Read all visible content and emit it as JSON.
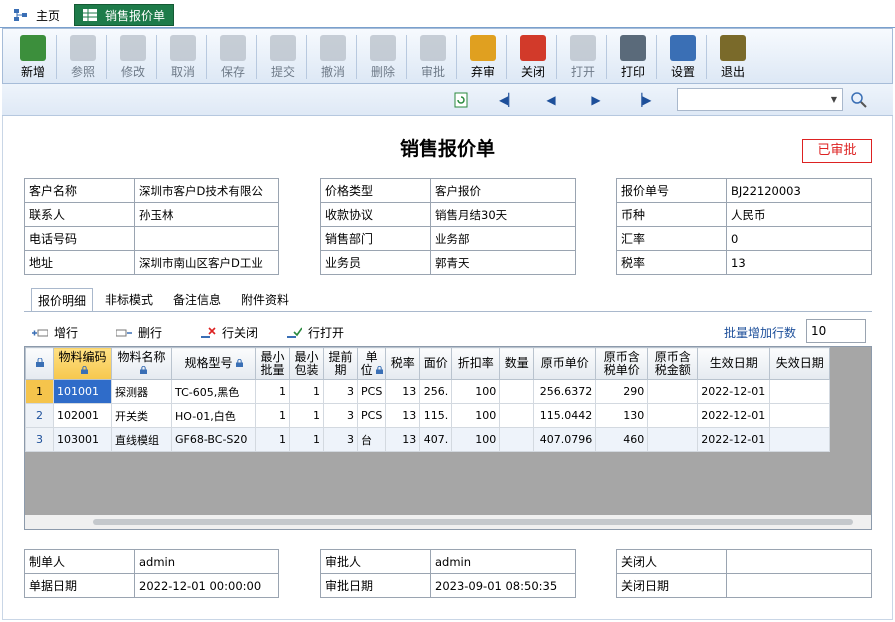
{
  "tabs": {
    "home": "主页",
    "active": "销售报价单"
  },
  "toolbar": [
    {
      "label": "新增",
      "icon": "new-doc-icon",
      "enabled": true
    },
    {
      "label": "参照",
      "icon": "reference-icon",
      "enabled": false
    },
    {
      "label": "修改",
      "icon": "edit-icon",
      "enabled": false
    },
    {
      "label": "取消",
      "icon": "undo-icon",
      "enabled": false
    },
    {
      "label": "保存",
      "icon": "save-icon",
      "enabled": false
    },
    {
      "label": "提交",
      "icon": "submit-icon",
      "enabled": false
    },
    {
      "label": "撤消",
      "icon": "revoke-icon",
      "enabled": false
    },
    {
      "label": "删除",
      "icon": "delete-icon",
      "enabled": false
    },
    {
      "label": "审批",
      "icon": "approve-icon",
      "enabled": false
    },
    {
      "label": "弃审",
      "icon": "unapprove-icon",
      "enabled": true
    },
    {
      "label": "关闭",
      "icon": "close-doc-icon",
      "enabled": true
    },
    {
      "label": "打开",
      "icon": "open-doc-icon",
      "enabled": false
    },
    {
      "label": "打印",
      "icon": "printer-icon",
      "enabled": true
    },
    {
      "label": "设置",
      "icon": "settings-icon",
      "enabled": true
    },
    {
      "label": "退出",
      "icon": "exit-icon",
      "enabled": true
    }
  ],
  "doc_title": "销售报价单",
  "status": "已审批",
  "header_left": [
    {
      "key": "客户名称",
      "value": "深圳市客户D技术有限公"
    },
    {
      "key": "联系人",
      "value": "孙玉林"
    },
    {
      "key": "电话号码",
      "value": ""
    },
    {
      "key": "地址",
      "value": "深圳市南山区客户D工业"
    }
  ],
  "header_mid": [
    {
      "key": "价格类型",
      "value": "客户报价"
    },
    {
      "key": "收款协议",
      "value": "销售月结30天"
    },
    {
      "key": "销售部门",
      "value": "业务部"
    },
    {
      "key": "业务员",
      "value": "郭青天"
    }
  ],
  "header_right": [
    {
      "key": "报价单号",
      "value": "BJ22120003"
    },
    {
      "key": "币种",
      "value": "人民币"
    },
    {
      "key": "汇率",
      "value": "0"
    },
    {
      "key": "税率",
      "value": "13"
    }
  ],
  "detail_tabs": [
    "报价明细",
    "非标模式",
    "备注信息",
    "附件资料"
  ],
  "grid_toolbar": {
    "add_row": "增行",
    "delete_row": "删行",
    "close_row": "行关闭",
    "open_row": "行打开",
    "batch_label": "批量增加行数",
    "batch_value": "10"
  },
  "grid": {
    "columns": [
      "物料编码",
      "物料名称",
      "规格型号",
      "最小批量",
      "最小包装",
      "提前期",
      "单位",
      "税率",
      "面价",
      "折扣率",
      "数量",
      "原币单价",
      "原币含税单价",
      "原币含税金额",
      "生效日期",
      "失效日期"
    ],
    "rows": [
      [
        "1",
        "101001",
        "探测器",
        "TC-605,黑色",
        "1",
        "1",
        "3",
        "PCS",
        "13",
        "256.",
        "100",
        "",
        "256.6372",
        "290",
        "",
        "2022-12-01",
        ""
      ],
      [
        "2",
        "102001",
        "开关类",
        "HO-01,白色",
        "1",
        "1",
        "3",
        "PCS",
        "13",
        "115.",
        "100",
        "",
        "115.0442",
        "130",
        "",
        "2022-12-01",
        ""
      ],
      [
        "3",
        "103001",
        "直线模组",
        "GF68-BC-S20",
        "1",
        "1",
        "3",
        "台",
        "13",
        "407.",
        "100",
        "",
        "407.0796",
        "460",
        "",
        "2022-12-01",
        ""
      ]
    ]
  },
  "footer_left": [
    {
      "key": "制单人",
      "value": "admin"
    },
    {
      "key": "单据日期",
      "value": "2022-12-01 00:00:00"
    }
  ],
  "footer_mid": [
    {
      "key": "审批人",
      "value": "admin"
    },
    {
      "key": "审批日期",
      "value": "2023-09-01 08:50:35"
    }
  ],
  "footer_right": [
    {
      "key": "关闭人",
      "value": ""
    },
    {
      "key": "关闭日期",
      "value": ""
    }
  ],
  "colors": {
    "tab_active": "#1e7b4a",
    "status": "#dd2222",
    "selected_cell": "#2f6cc9",
    "highlight_header": "#f6c74d"
  }
}
